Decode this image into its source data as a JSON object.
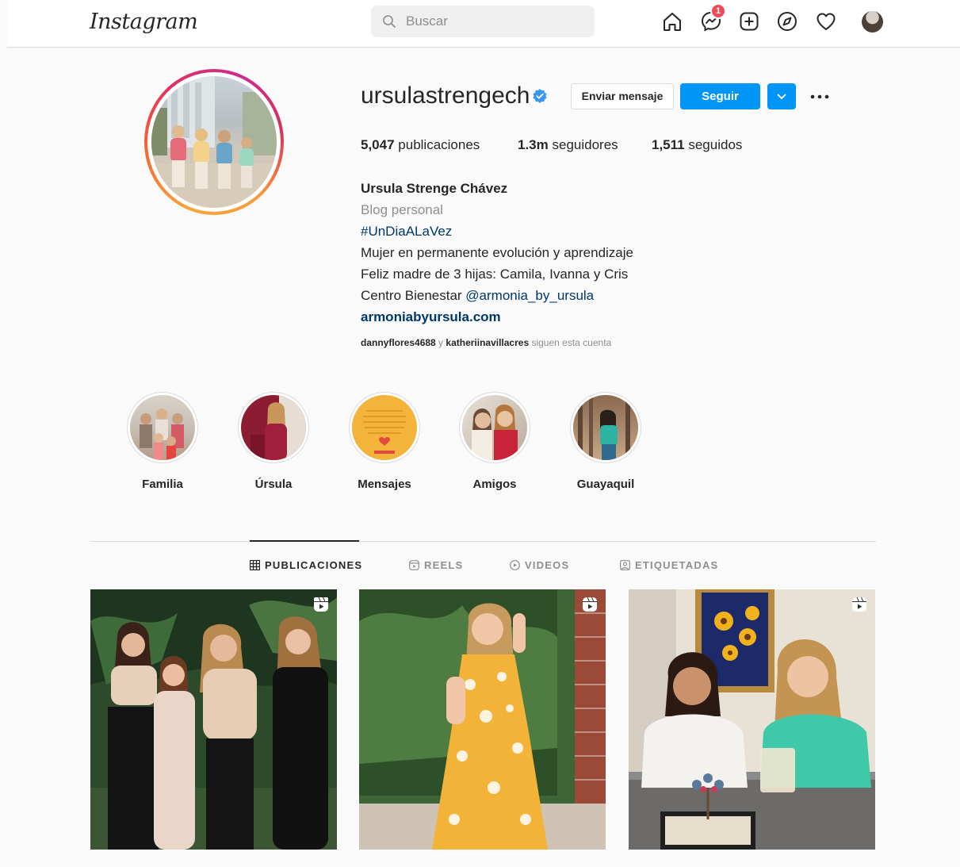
{
  "app": {
    "logo": "Instagram"
  },
  "search": {
    "placeholder": "Buscar"
  },
  "nav": {
    "icons": [
      "home-icon",
      "messenger-icon",
      "new-post-icon",
      "explore-icon",
      "activity-icon",
      "avatar"
    ],
    "messenger_badge": "1"
  },
  "profile": {
    "username": "ursulastrengech",
    "verified": true,
    "buttons": {
      "message": "Enviar mensaje",
      "follow": "Seguir"
    },
    "stats": {
      "posts_count": "5,047",
      "posts_label": "publicaciones",
      "followers_count": "1.3m",
      "followers_label": "seguidores",
      "following_count": "1,511",
      "following_label": "seguidos"
    },
    "bio": {
      "name": "Ursula Strenge Chávez",
      "category": "Blog personal",
      "hashtag": "#UnDiaALaVez",
      "line1": "Mujer en permanente evolución y aprendizaje",
      "line2": "Feliz madre de 3 hijas: Camila, Ivanna y Cris",
      "line3_prefix": "Centro Bienestar ",
      "line3_mention": "@armonia_by_ursula",
      "website": "armoniabyursula.com"
    },
    "followed_by": {
      "user1": "dannyflores4688",
      "connector": " y ",
      "user2": "katheriinavillacres",
      "suffix": " siguen esta cuenta"
    }
  },
  "highlights": [
    {
      "label": "Familia"
    },
    {
      "label": "Úrsula"
    },
    {
      "label": "Mensajes"
    },
    {
      "label": "Amigos"
    },
    {
      "label": "Guayaquil"
    }
  ],
  "tabs": [
    {
      "label": "PUBLICACIONES",
      "icon": "grid-icon",
      "active": true
    },
    {
      "label": "REELS",
      "icon": "reels-icon",
      "active": false
    },
    {
      "label": "VIDEOS",
      "icon": "video-icon",
      "active": false
    },
    {
      "label": "ETIQUETADAS",
      "icon": "tagged-icon",
      "active": false
    }
  ],
  "posts": [
    {
      "type": "reel",
      "icon": "reel-icon"
    },
    {
      "type": "reel",
      "icon": "reel-icon"
    },
    {
      "type": "reel",
      "icon": "reel-icon"
    }
  ],
  "colors": {
    "accent": "#0095f6",
    "badge": "#ed4956",
    "link": "#00376b",
    "muted": "#8e8e8e",
    "text": "#262626",
    "background": "#fafafa"
  }
}
